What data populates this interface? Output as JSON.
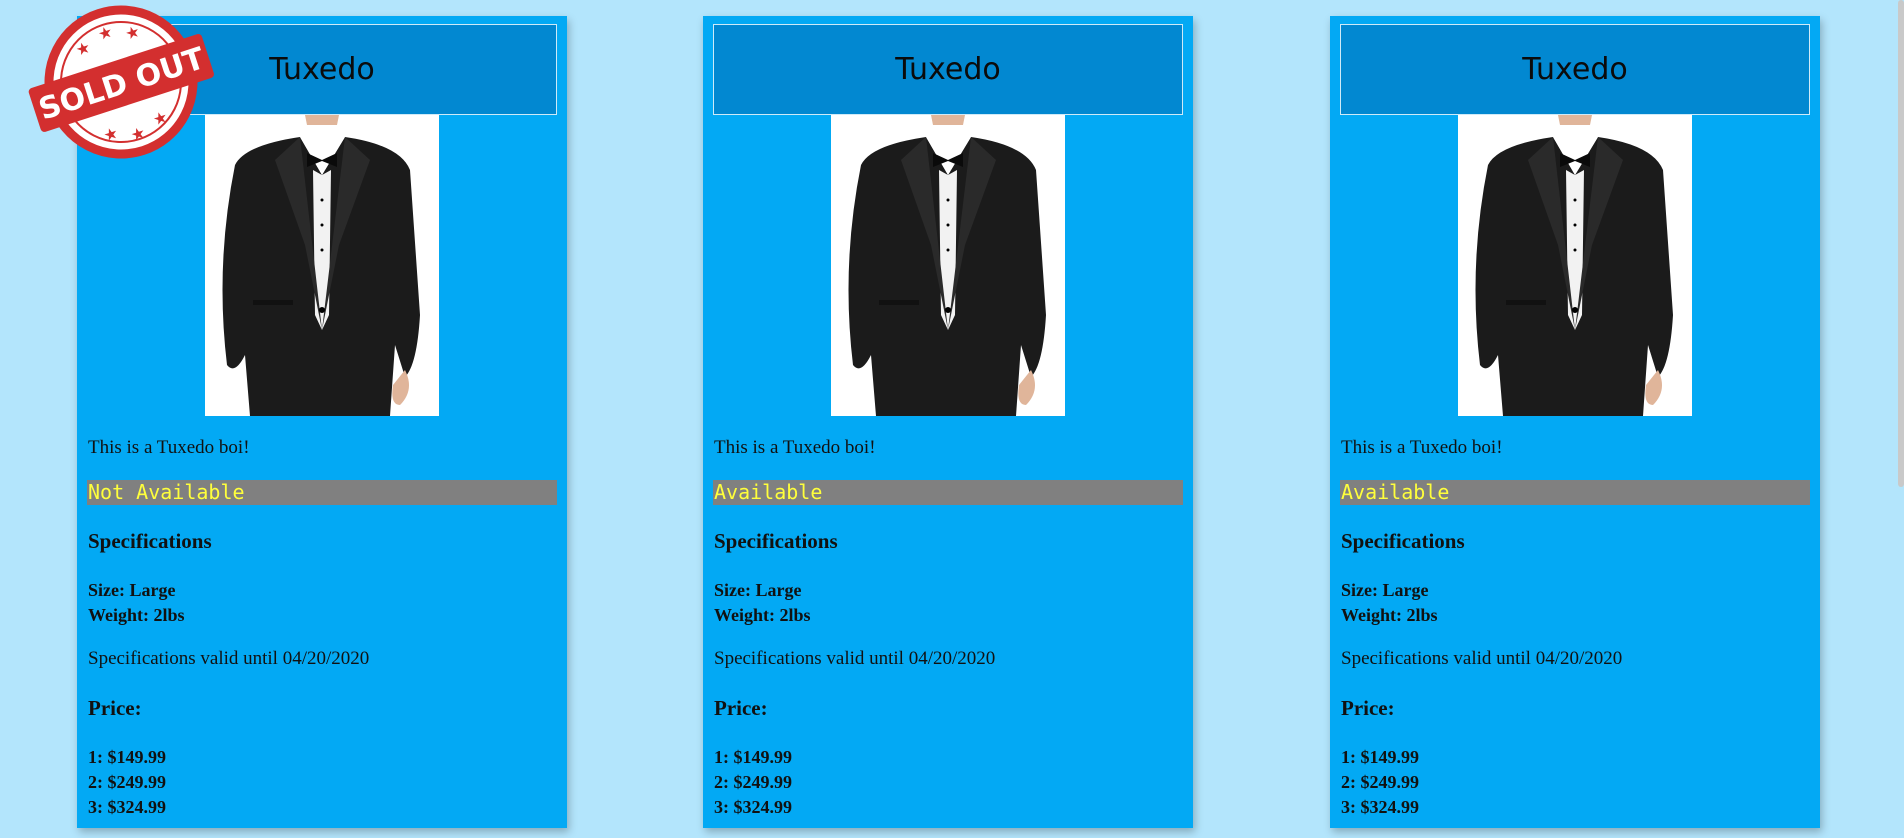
{
  "products": [
    {
      "title": "Tuxedo",
      "description": "This is a Tuxedo boi!",
      "availability": "Not Available",
      "sold_out": true,
      "specs_heading": "Specifications",
      "size": "Size: Large",
      "weight": "Weight: 2lbs",
      "valid_until": "Specifications valid until 04/20/2020",
      "price_heading": "Price:",
      "prices": [
        "1: $149.99",
        "2: $249.99",
        "3: $324.99"
      ]
    },
    {
      "title": "Tuxedo",
      "description": "This is a Tuxedo boi!",
      "availability": "Available",
      "sold_out": false,
      "specs_heading": "Specifications",
      "size": "Size: Large",
      "weight": "Weight: 2lbs",
      "valid_until": "Specifications valid until 04/20/2020",
      "price_heading": "Price:",
      "prices": [
        "1: $149.99",
        "2: $249.99",
        "3: $324.99"
      ]
    },
    {
      "title": "Tuxedo",
      "description": "This is a Tuxedo boi!",
      "availability": "Available",
      "sold_out": false,
      "specs_heading": "Specifications",
      "size": "Size: Large",
      "weight": "Weight: 2lbs",
      "valid_until": "Specifications valid until 04/20/2020",
      "price_heading": "Price:",
      "prices": [
        "1: $149.99",
        "2: $249.99",
        "3: $324.99"
      ]
    }
  ],
  "stamp": {
    "text": "SOLD OUT",
    "icon": "sold-out-stamp"
  },
  "colors": {
    "background": "#b3e5fc",
    "card": "#03a9f4",
    "title_box": "#0288d1",
    "availability_bg": "#808080",
    "availability_text": "#ffff3b",
    "stamp": "#d32f2f"
  }
}
